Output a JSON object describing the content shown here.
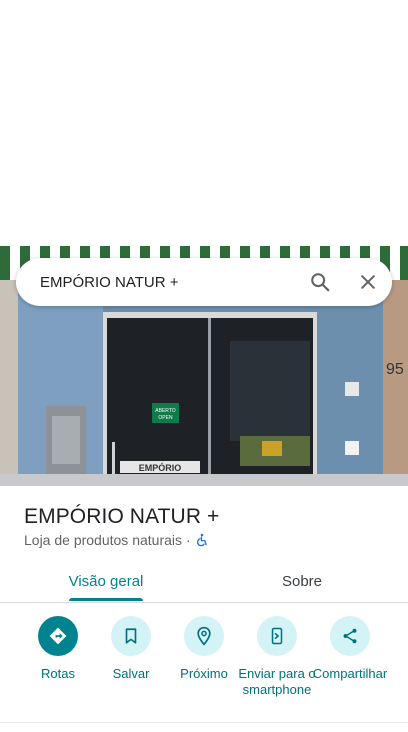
{
  "search": {
    "query": "EMPÓRIO NATUR +"
  },
  "place": {
    "name": "EMPÓRIO NATUR +",
    "category": "Loja de produtos naturais",
    "separator": "·"
  },
  "photo": {
    "sign_text": "ABERTO OPEN",
    "store_label": "EMPÓRIO",
    "number": "95"
  },
  "tabs": [
    {
      "label": "Visão geral",
      "active": true
    },
    {
      "label": "Sobre",
      "active": false
    }
  ],
  "actions": [
    {
      "label": "Rotas",
      "icon": "directions-icon"
    },
    {
      "label": "Salvar",
      "icon": "bookmark-icon"
    },
    {
      "label": "Próximo",
      "icon": "nearby-icon"
    },
    {
      "label": "Enviar para o smartphone",
      "icon": "send-to-phone-icon"
    },
    {
      "label": "Compartilhar",
      "icon": "share-icon"
    }
  ],
  "colors": {
    "accent": "#00838f",
    "action_bg": "#d4f3f7"
  }
}
